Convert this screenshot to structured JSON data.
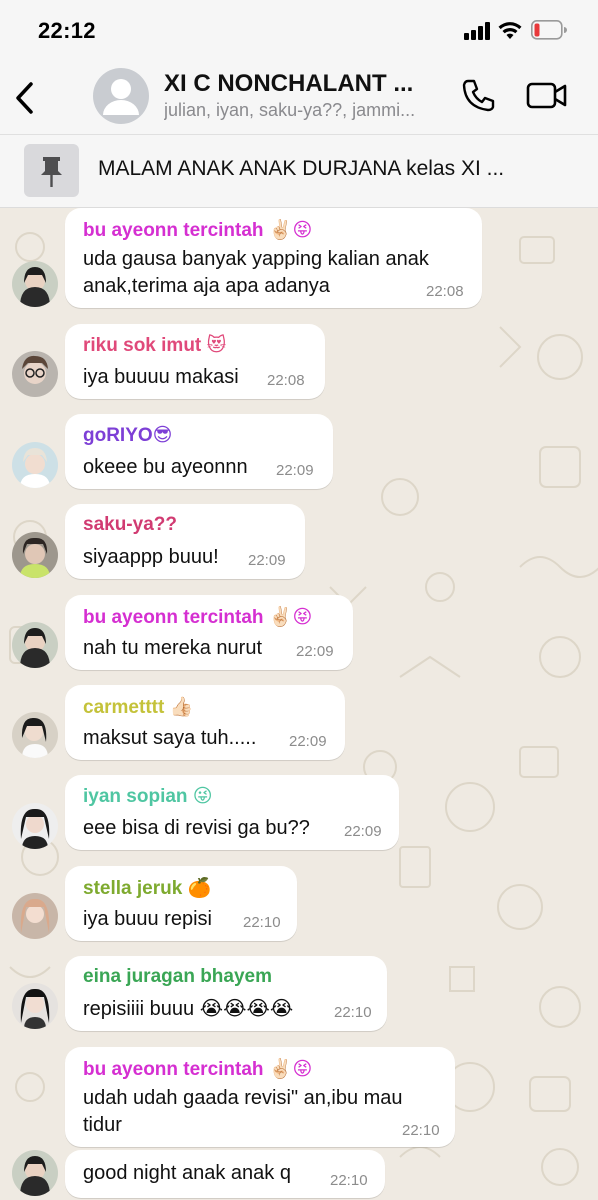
{
  "status_bar": {
    "time": "22:12"
  },
  "header": {
    "title": "XI C NONCHALANT ...",
    "subtitle": "julian, iyan, saku-ya??, jammi..."
  },
  "pinned": {
    "text": "MALAM ANAK ANAK DURJANA kelas XI ..."
  },
  "colors": {
    "background": "#efeae2",
    "bubble": "#ffffff",
    "sender_bu_ayeonn": "#d52fd1",
    "sender_riku": "#e0497a",
    "sender_goriyo": "#7d3fd6",
    "sender_sakuya": "#d13b72",
    "sender_carmettt": "#c4c23a",
    "sender_iyan": "#4fc6a2",
    "sender_stella": "#7eaa2f",
    "sender_eina": "#3aa655"
  },
  "messages": [
    {
      "sender": "bu ayeonn tercintah ✌🏻😝",
      "line1": "uda gausa banyak yapping kalian anak",
      "line2": "anak,terima aja apa adanya",
      "time": "22:08"
    },
    {
      "sender": "riku sok imut 😻",
      "line1": "iya buuuu makasi",
      "time": "22:08"
    },
    {
      "sender": "goRIYO😎",
      "line1": "okeee bu ayeonnn",
      "time": "22:09"
    },
    {
      "sender": "saku-ya??",
      "line1": "siyaappp buuu!",
      "time": "22:09"
    },
    {
      "sender": "bu ayeonn tercintah ✌🏻😝",
      "line1": "nah tu mereka nurut",
      "time": "22:09"
    },
    {
      "sender": "carmetttt 👍🏻",
      "line1": "maksut saya tuh.....",
      "time": "22:09"
    },
    {
      "sender": "iyan sopian 😜",
      "line1": "eee bisa di revisi ga bu??",
      "time": "22:09"
    },
    {
      "sender": "stella jeruk 🍊",
      "line1": "iya buuu repisi",
      "time": "22:10"
    },
    {
      "sender": "eina juragan bhayem",
      "line1": "repisiiii buuu 😭😭😭😭",
      "time": "22:10"
    },
    {
      "sender": "bu ayeonn tercintah ✌🏻😝",
      "line1": "udah udah gaada revisi\" an,ibu mau",
      "line2": "tidur",
      "time": "22:10"
    },
    {
      "line1": "good night anak anak q",
      "time": "22:10"
    }
  ]
}
